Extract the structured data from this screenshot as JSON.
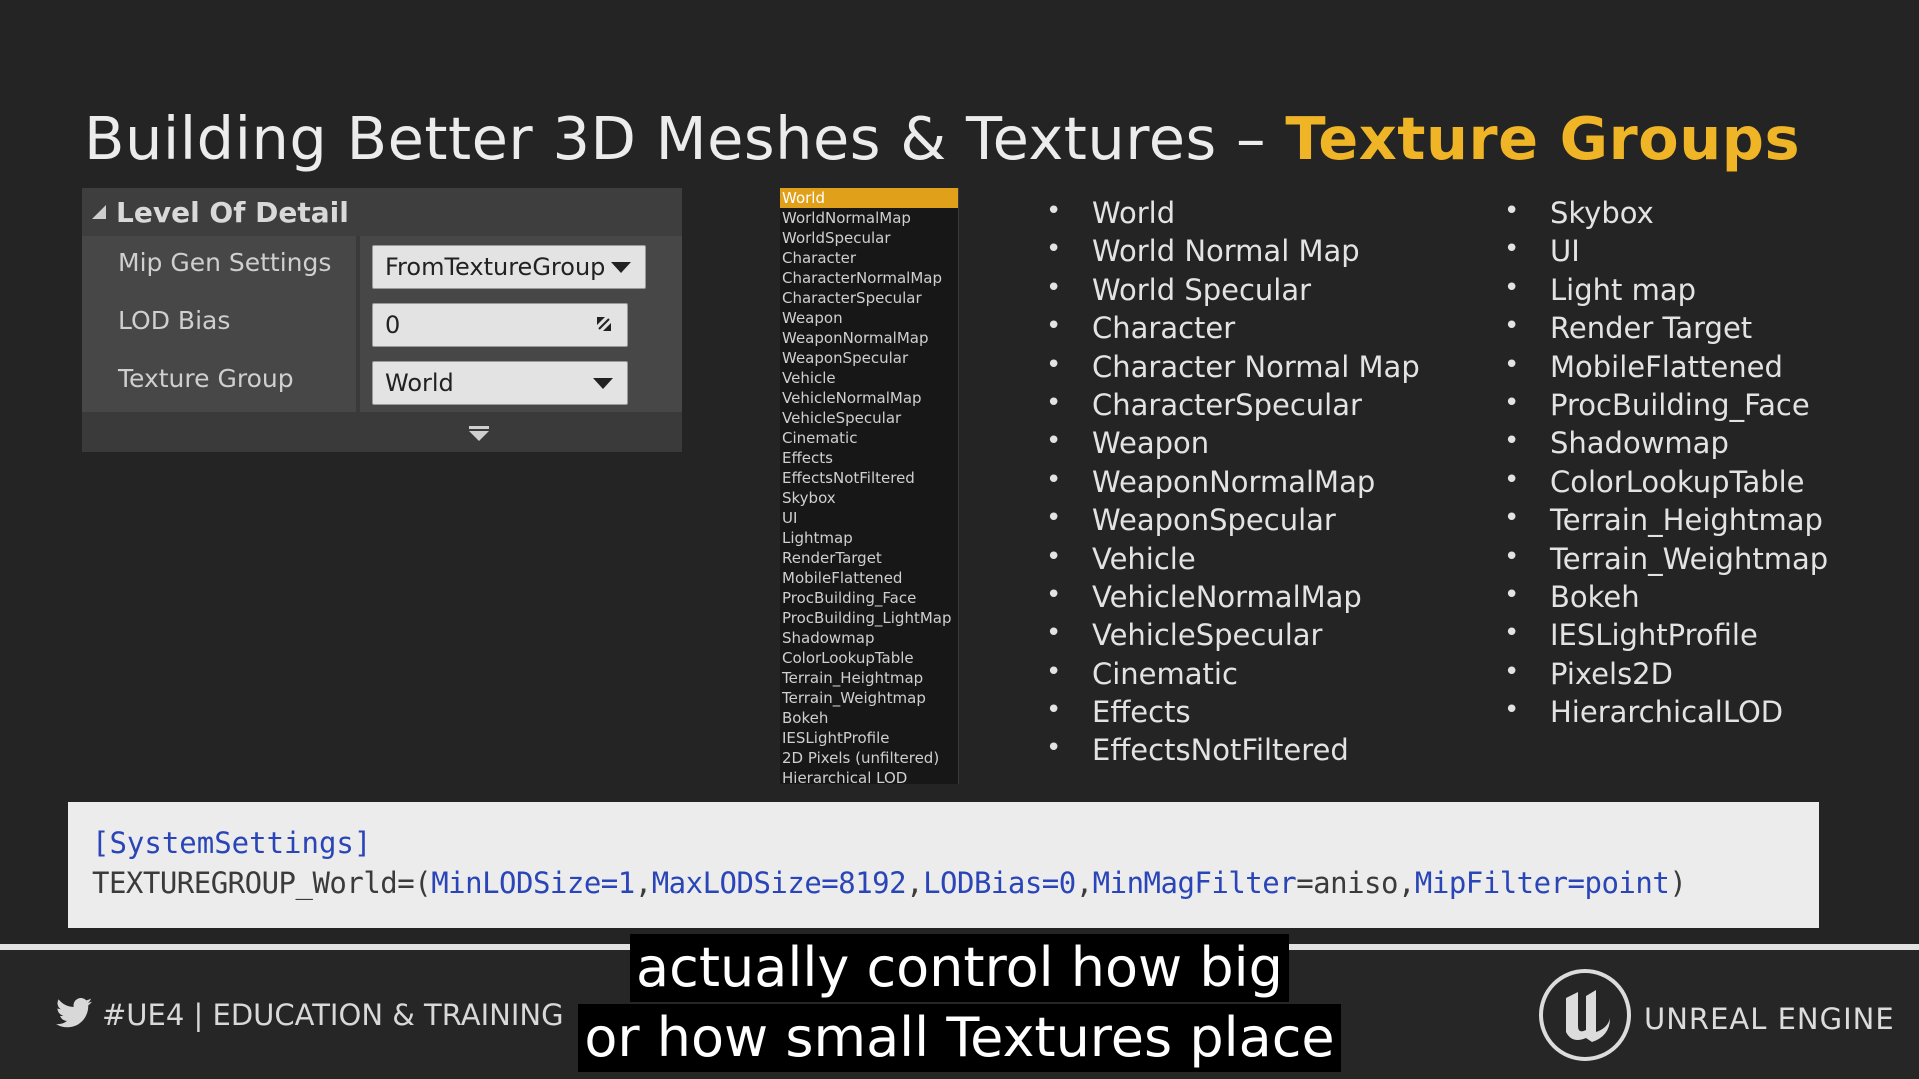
{
  "title": {
    "main": "Building Better 3D Meshes & Textures",
    "dash": "–",
    "accent": "Texture Groups"
  },
  "lod_panel": {
    "header": "Level Of Detail",
    "rows": [
      {
        "label": "Mip Gen Settings",
        "value": "FromTextureGroup"
      },
      {
        "label": "LOD Bias",
        "value": "0"
      },
      {
        "label": "Texture Group",
        "value": "World"
      }
    ]
  },
  "dropdown_items": [
    "World",
    "WorldNormalMap",
    "WorldSpecular",
    "Character",
    "CharacterNormalMap",
    "CharacterSpecular",
    "Weapon",
    "WeaponNormalMap",
    "WeaponSpecular",
    "Vehicle",
    "VehicleNormalMap",
    "VehicleSpecular",
    "Cinematic",
    "Effects",
    "EffectsNotFiltered",
    "Skybox",
    "UI",
    "Lightmap",
    "RenderTarget",
    "MobileFlattened",
    "ProcBuilding_Face",
    "ProcBuilding_LightMap",
    "Shadowmap",
    "ColorLookupTable",
    "Terrain_Heightmap",
    "Terrain_Weightmap",
    "Bokeh",
    "IESLightProfile",
    "2D Pixels (unfiltered)",
    "Hierarchical LOD"
  ],
  "dropdown_selected": "World",
  "list1": [
    "World",
    "World Normal Map",
    "World Specular",
    "Character",
    "Character Normal Map",
    "CharacterSpecular",
    "Weapon",
    "WeaponNormalMap",
    "WeaponSpecular",
    "Vehicle",
    "VehicleNormalMap",
    "VehicleSpecular",
    "Cinematic",
    "Effects",
    "EffectsNotFiltered"
  ],
  "list2": [
    "Skybox",
    "UI",
    "Light map",
    "Render Target",
    "MobileFlattened",
    "ProcBuilding_Face",
    "Shadowmap",
    "ColorLookupTable",
    "Terrain_Heightmap",
    "Terrain_Weightmap",
    "Bokeh",
    "IESLightProfile",
    "Pixels2D",
    "HierarchicalLOD"
  ],
  "code": {
    "section": "[SystemSettings]",
    "group": "TEXTUREGROUP_World=(",
    "min": "MinLODSize=1",
    "max": "MaxLODSize=8192",
    "bias": "LODBias=0",
    "mag_key": "MinMagFilter",
    "mag_val": "=aniso",
    "mip": "MipFilter=point",
    "close": ")",
    "comma": ","
  },
  "footer": {
    "hashtag": "#UE4 | EDUCATION & TRAINING",
    "brand": "UNREAL ENGINE"
  },
  "subtitles": [
    "actually control how big",
    "or how small Textures place"
  ],
  "colors": {
    "accent": "#f0b526",
    "selected": "#e0a019",
    "code_kw": "#2a45b8"
  }
}
